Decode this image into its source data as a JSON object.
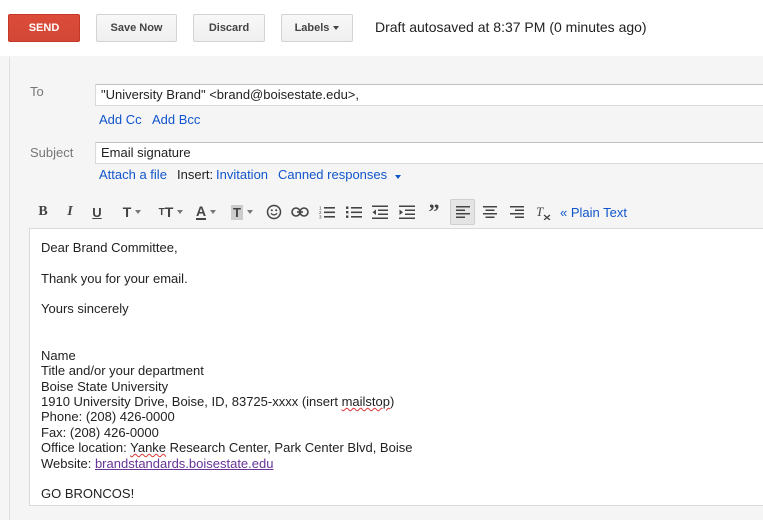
{
  "toolbar": {
    "send_label": "SEND",
    "save_label": "Save Now",
    "discard_label": "Discard",
    "labels_label": "Labels",
    "autosave_text": "Draft autosaved at 8:37 PM (0 minutes ago)"
  },
  "compose": {
    "to_label": "To",
    "to_value": "\"University Brand\" <brand@boisestate.edu>,",
    "add_cc": "Add Cc",
    "add_bcc": "Add Bcc",
    "subject_label": "Subject",
    "subject_value": "Email signature",
    "attach_file": "Attach a file",
    "insert_label": "Insert:",
    "invitation": "Invitation",
    "canned_responses": "Canned responses"
  },
  "format": {
    "plain_text": "« Plain Text"
  },
  "body": {
    "greeting": "Dear Brand Committee,",
    "line1": "Thank you for your email.",
    "closing": "Yours sincerely",
    "sig_name": "Name",
    "sig_title": "Title and/or your department",
    "sig_univ": "Boise State University",
    "sig_addr_prefix": "1910 University Drive, Boise, ID, 83725-xxxx (insert ",
    "sig_addr_word": "mailstop",
    "sig_addr_suffix": ")",
    "sig_phone": "Phone: (208) 426-0000",
    "sig_fax": "Fax: (208) 426-0000",
    "sig_office_prefix": "Office location: ",
    "sig_office_word": "Yanke",
    "sig_office_suffix": " Research Center, Park Center Blvd, Boise",
    "sig_web_prefix": "Website: ",
    "sig_web_link": "brandstandards.boisestate.edu",
    "sign_off": "GO BRONCOS!"
  }
}
